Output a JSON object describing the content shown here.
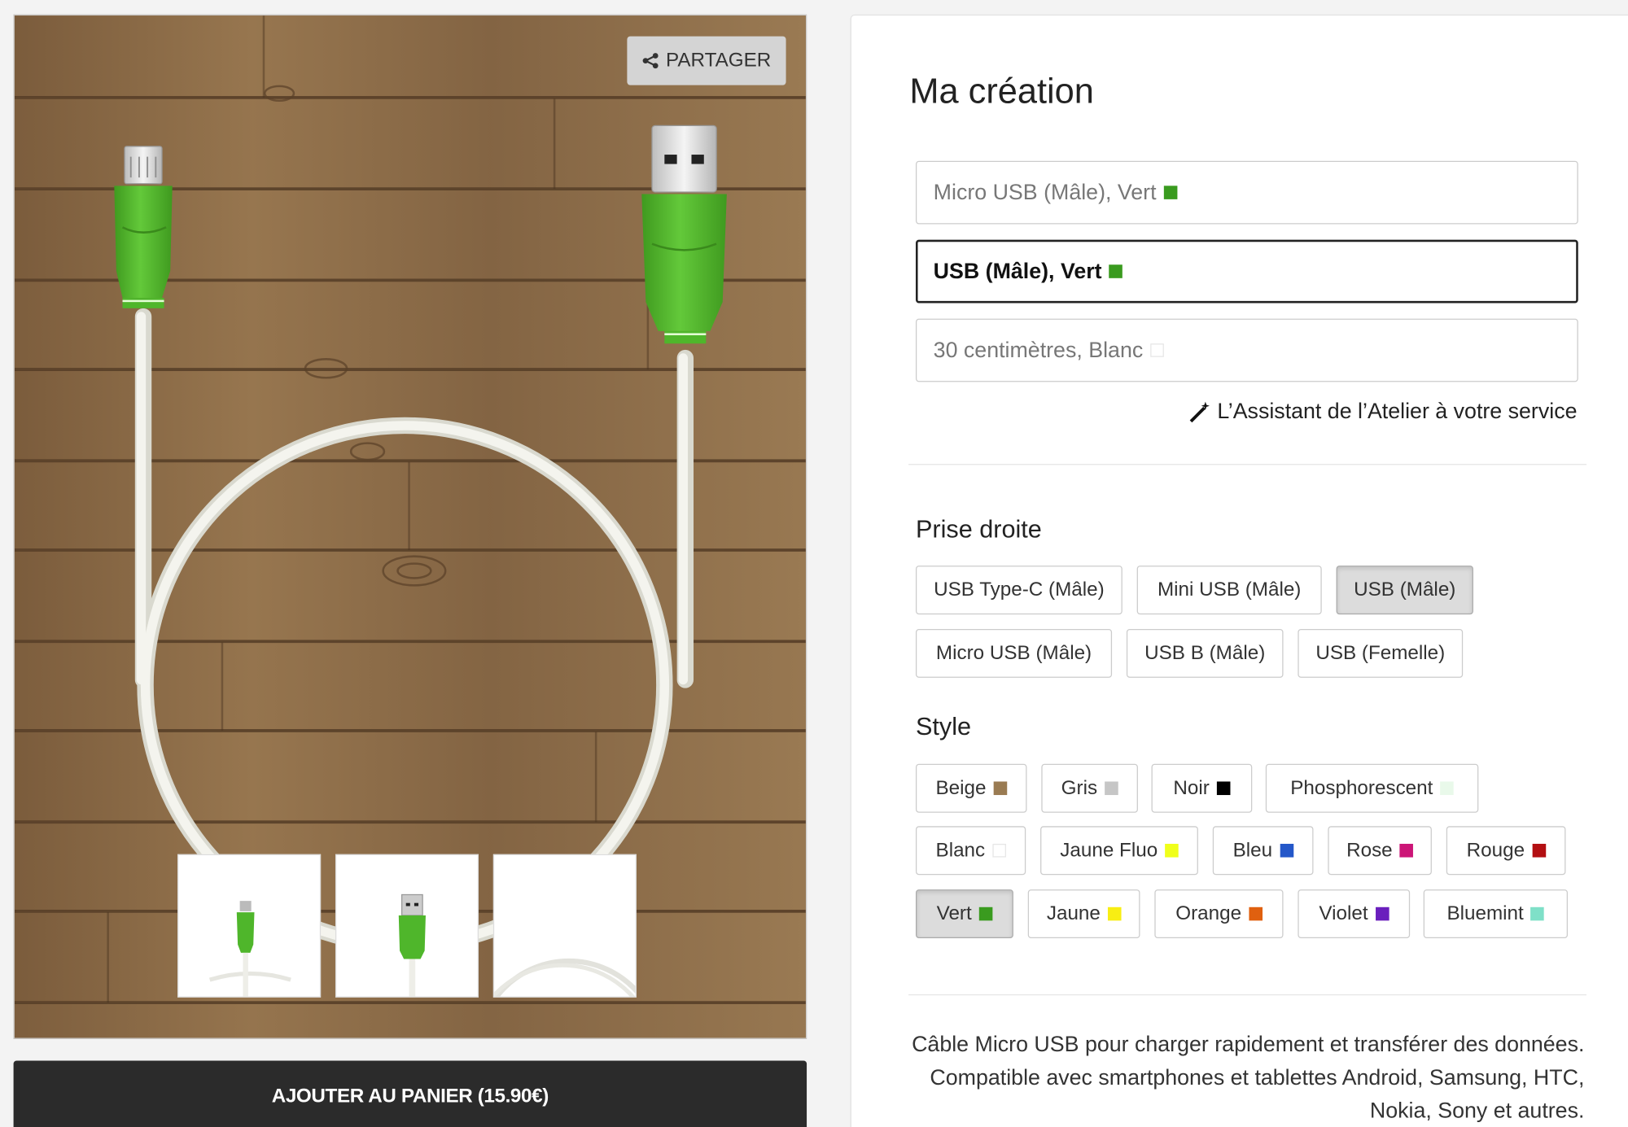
{
  "preview": {
    "share_label": "PARTAGER",
    "cart_label": "AJOUTER AU PANIER (15.90€)"
  },
  "panel": {
    "title": "Ma création",
    "summary": [
      {
        "text": "Micro USB (Mâle), Vert",
        "swatch": "#3a9b1f",
        "active": false
      },
      {
        "text": "USB (Mâle), Vert",
        "swatch": "#3a9b1f",
        "active": true
      },
      {
        "text": "30 centimètres, Blanc",
        "swatch": "#ffffff",
        "active": false
      }
    ],
    "assistant_label": "L’Assistant de l’Atelier à votre service",
    "plug_section": {
      "title": "Prise droite",
      "options": [
        {
          "label": "USB Type-C (Mâle)",
          "selected": false
        },
        {
          "label": "Mini USB (Mâle)",
          "selected": false
        },
        {
          "label": "USB (Mâle)",
          "selected": true
        },
        {
          "label": "Micro USB (Mâle)",
          "selected": false
        },
        {
          "label": "USB B (Mâle)",
          "selected": false
        },
        {
          "label": "USB (Femelle)",
          "selected": false
        }
      ]
    },
    "style_section": {
      "title": "Style",
      "options": [
        {
          "label": "Beige",
          "color": "#9a7b52",
          "selected": false
        },
        {
          "label": "Gris",
          "color": "#c6c6c6",
          "selected": false
        },
        {
          "label": "Noir",
          "color": "#000000",
          "selected": false
        },
        {
          "label": "Phosphorescent",
          "color": "#e9f9ea",
          "selected": false
        },
        {
          "label": "Blanc",
          "color": "#ffffff",
          "selected": false
        },
        {
          "label": "Jaune Fluo",
          "color": "#f0ff1a",
          "selected": false
        },
        {
          "label": "Bleu",
          "color": "#2457c9",
          "selected": false
        },
        {
          "label": "Rose",
          "color": "#cc1577",
          "selected": false
        },
        {
          "label": "Rouge",
          "color": "#b30f12",
          "selected": false
        },
        {
          "label": "Vert",
          "color": "#3a9b1f",
          "selected": true
        },
        {
          "label": "Jaune",
          "color": "#f8ee13",
          "selected": false
        },
        {
          "label": "Orange",
          "color": "#e0600f",
          "selected": false
        },
        {
          "label": "Violet",
          "color": "#6a1fbd",
          "selected": false
        },
        {
          "label": "Bluemint",
          "color": "#7fe0c8",
          "selected": false
        }
      ]
    },
    "description": "Câble Micro USB pour charger rapidement et transférer des données. Compatible avec smartphones et tablettes Android, Samsung, HTC, Nokia, Sony et autres."
  },
  "colors": {
    "cable_green": "#4fb62b",
    "cable_white": "#f2f2ec",
    "wood": "#8a6a46",
    "cart_bg": "#2b2b2b"
  }
}
